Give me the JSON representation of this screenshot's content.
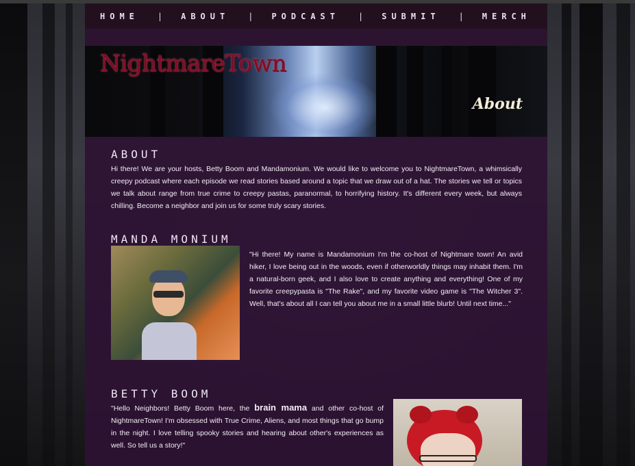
{
  "nav": {
    "items": [
      "HOME",
      "ABOUT",
      "PODCAST",
      "SUBMIT",
      "MERCH"
    ],
    "separator": "|"
  },
  "banner": {
    "site_title": "NightmareTown",
    "page_label": "About"
  },
  "about": {
    "heading": "ABOUT",
    "text": "Hi there! We are your hosts, Betty Boom and Mandamonium. We would like to welcome you to NightmareTown, a whimsically creepy podcast where each episode we read stories based around a topic that we draw out of a hat. The stories we tell or topics we talk about range from true crime to creepy pastas, paranormal, to horrifying history. It's different every week, but always chilling. Become a neighbor and join us for some truly scary stories."
  },
  "manda": {
    "heading": "MANDA MONIUM",
    "text": "\"Hi there! My name is Mandamonium I'm the co-host of Nightmare town! An avid hiker, I love being out in the woods, even if otherworldly things may inhabit them. I'm a natural-born geek, and I also love to create anything and everything! One of my favorite creepypasta is \"The Rake\", and my favorite video game is \"The Witcher 3\". Well, that's about all I can tell you about me in a small little blurb! Until next time...\""
  },
  "betty": {
    "heading": "BETTY BOOM",
    "text_before": "\"Hello Neighbors! Betty Boom here, the ",
    "text_bold": "brain mama",
    "text_after": " and other co-host of NightmareTown! I'm obsessed with True Crime, Aliens, and most things that go bump in the night. I love telling spooky stories and hearing about other's experiences as well. So tell us a story!\""
  },
  "colors": {
    "panel": "#2d1234",
    "nav_bg": "#22101f",
    "title_red": "#7d0f24",
    "text": "#f4eef6"
  }
}
